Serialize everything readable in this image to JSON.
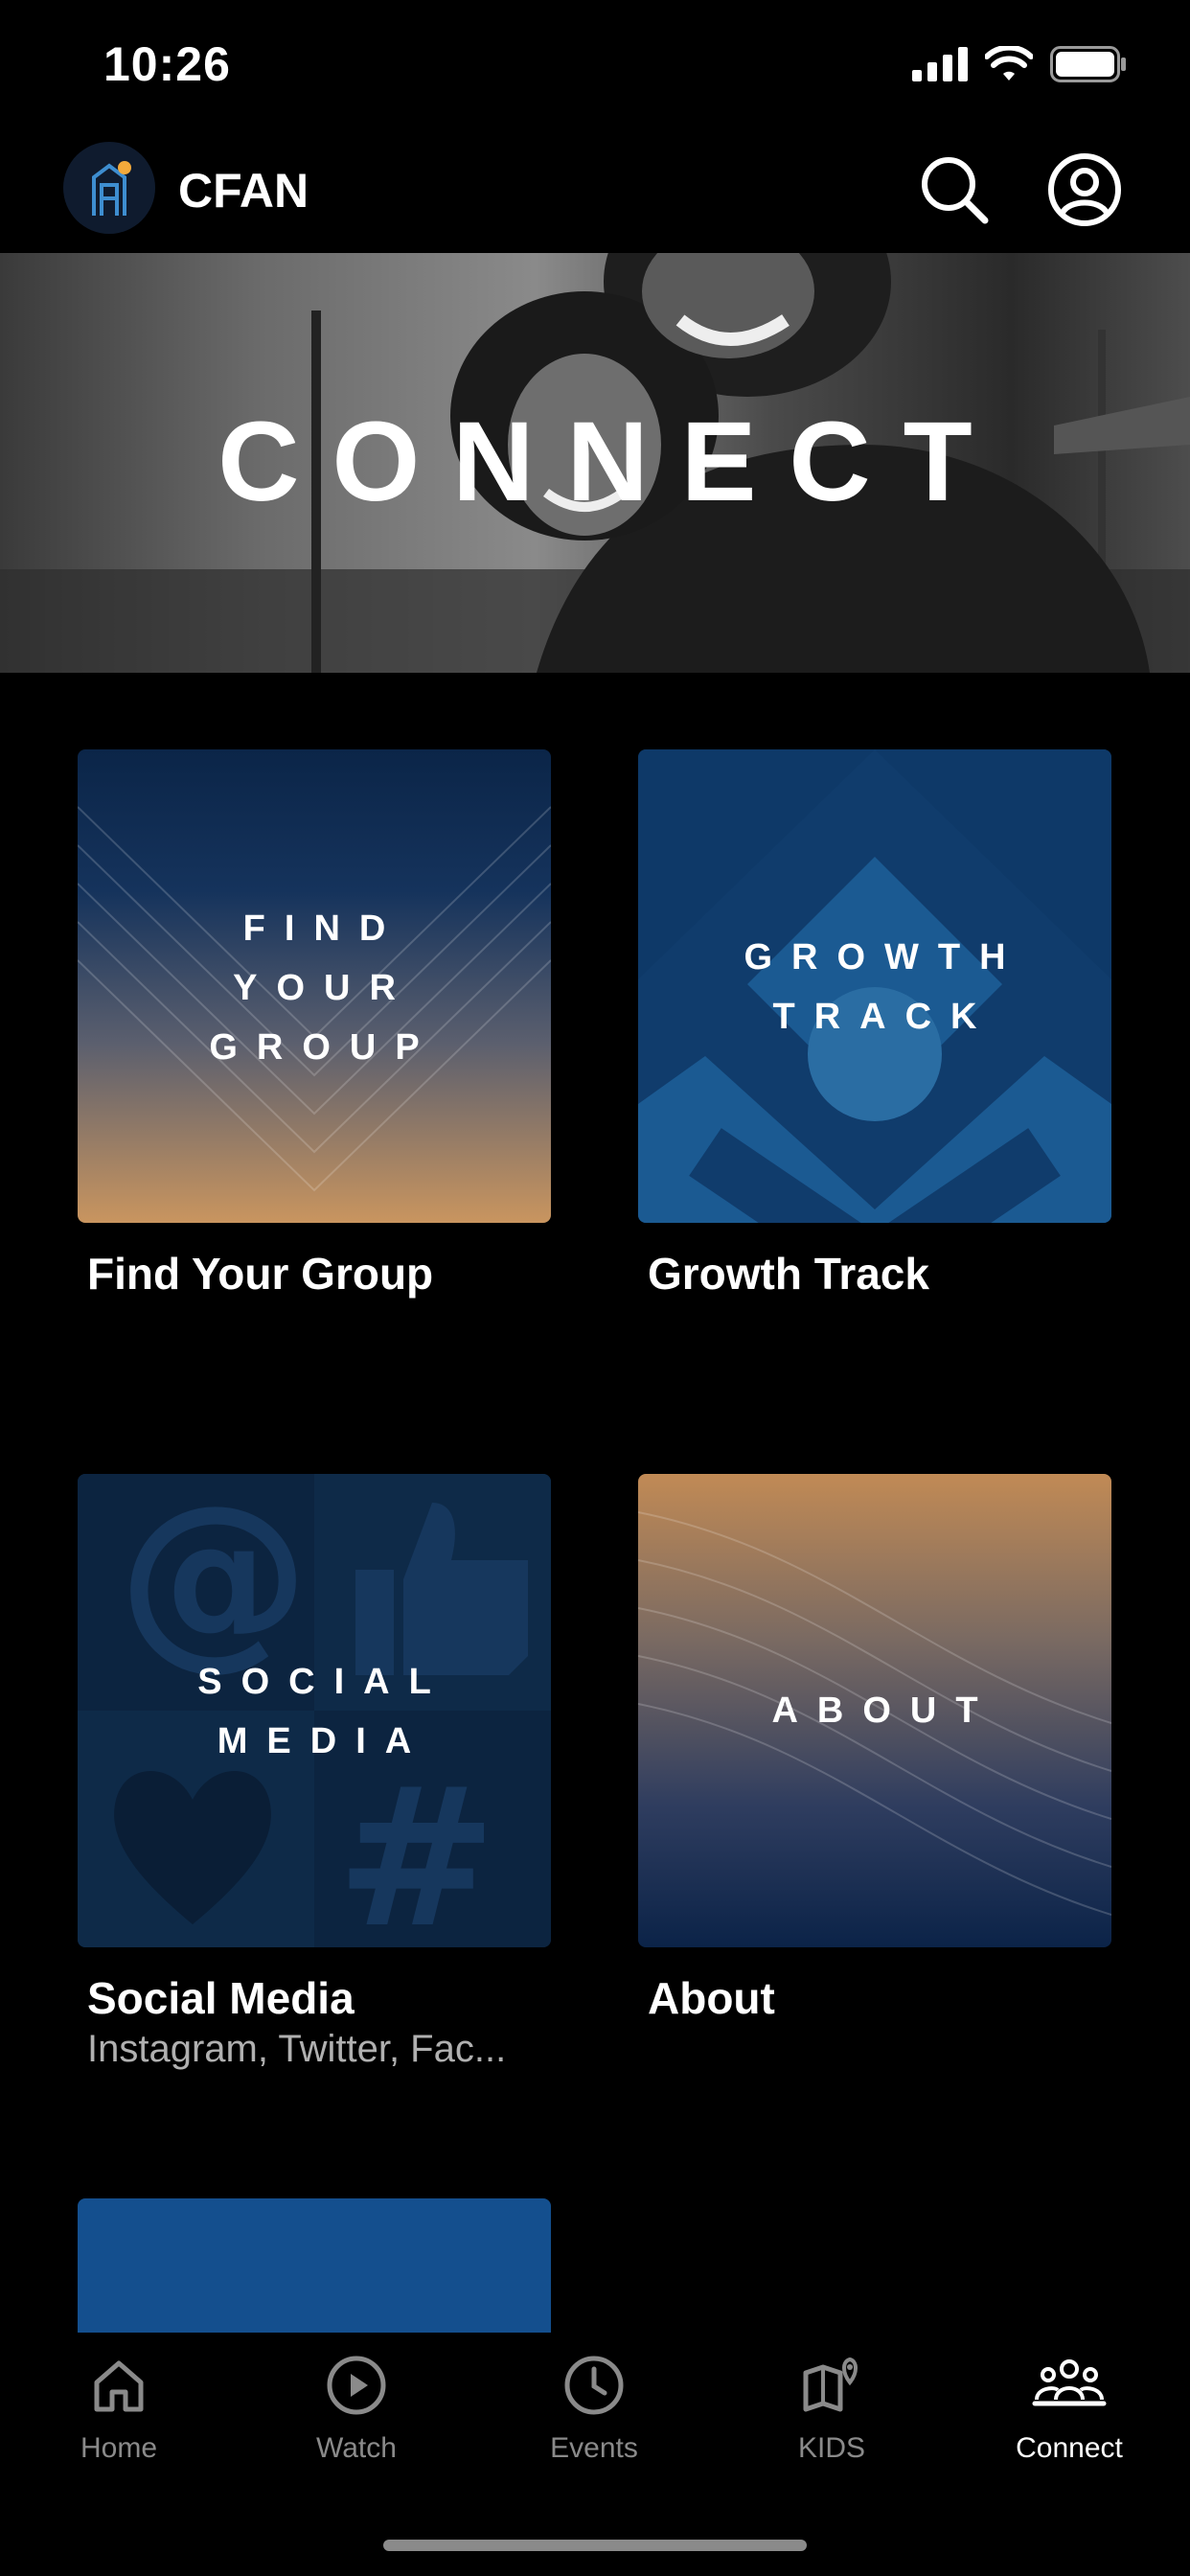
{
  "status": {
    "time": "10:26"
  },
  "header": {
    "app_name": "CFAN"
  },
  "hero": {
    "title": "CONNECT"
  },
  "tiles": [
    {
      "caption_lines": [
        "FIND",
        "YOUR",
        "GROUP"
      ],
      "label": "Find Your Group",
      "subtitle": ""
    },
    {
      "caption_lines": [
        "GROWTH",
        "TRACK"
      ],
      "label": "Growth Track",
      "subtitle": ""
    },
    {
      "caption_lines": [
        "SOCIAL",
        "MEDIA"
      ],
      "label": "Social Media",
      "subtitle": "Instagram, Twitter, Fac..."
    },
    {
      "caption_lines": [
        "ABOUT"
      ],
      "label": "About",
      "subtitle": ""
    }
  ],
  "tabbar": {
    "items": [
      {
        "label": "Home",
        "icon": "home-icon",
        "active": false
      },
      {
        "label": "Watch",
        "icon": "play-circle-icon",
        "active": false
      },
      {
        "label": "Events",
        "icon": "clock-icon",
        "active": false
      },
      {
        "label": "KIDS",
        "icon": "map-pin-icon",
        "active": false
      },
      {
        "label": "Connect",
        "icon": "people-icon",
        "active": true
      }
    ]
  },
  "colors": {
    "background": "#000000",
    "accent": "#ffffff",
    "inactive": "#8a8a8a"
  }
}
